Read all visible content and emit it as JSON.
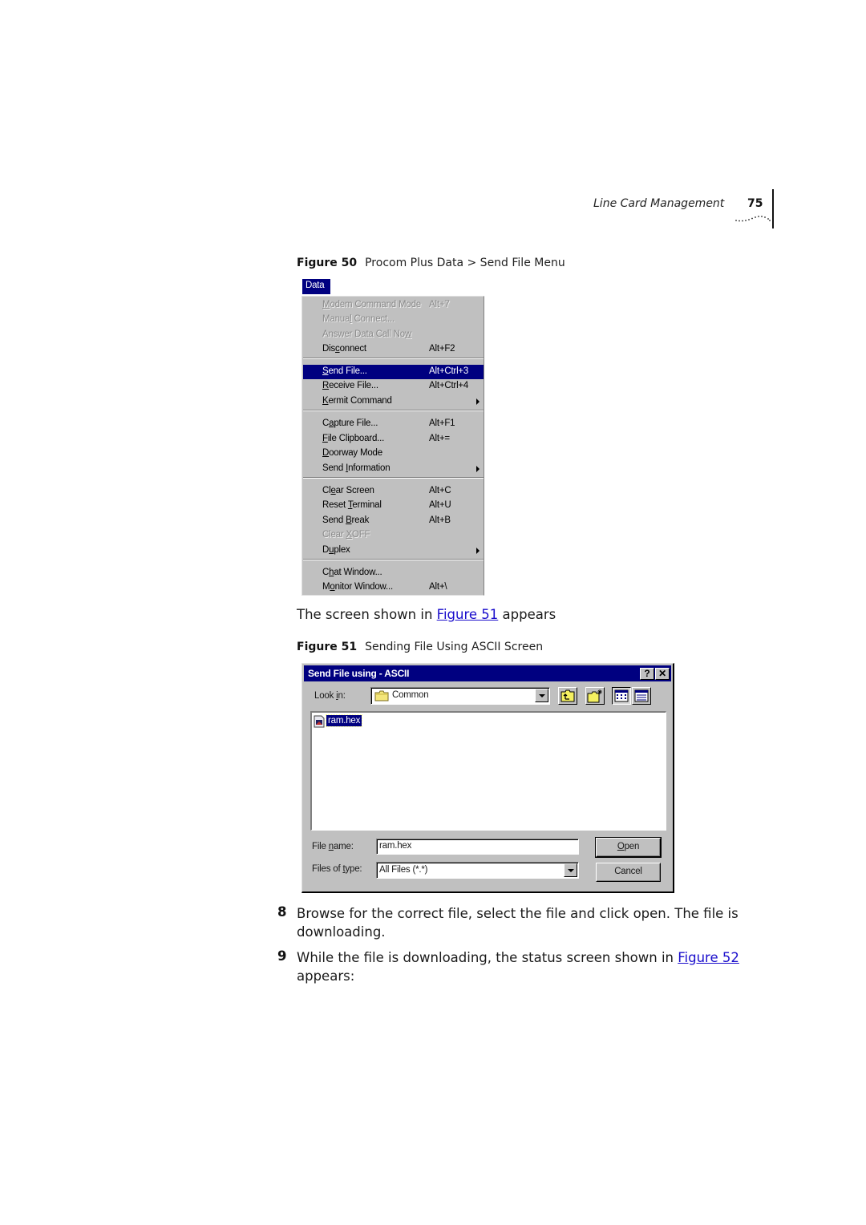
{
  "header": {
    "section_title": "Line Card Management",
    "page_number": "75"
  },
  "figure50": {
    "label": "Figure 50",
    "caption": "Procom Plus Data > Send File Menu",
    "menu": {
      "title": "Data",
      "items": [
        {
          "label": "Modem Command Mode",
          "shortcut": "Alt+7",
          "state": "disabled",
          "submenu": false
        },
        {
          "label": "Manual Connect...",
          "shortcut": "",
          "state": "disabled",
          "submenu": false
        },
        {
          "label": "Answer Data Call Now",
          "shortcut": "",
          "state": "disabled",
          "submenu": false
        },
        {
          "label": "Disconnect",
          "shortcut": "Alt+F2",
          "state": "enabled",
          "submenu": false
        },
        {
          "label": "Send File...",
          "shortcut": "Alt+Ctrl+3",
          "state": "selected",
          "submenu": false
        },
        {
          "label": "Receive File...",
          "shortcut": "Alt+Ctrl+4",
          "state": "enabled",
          "submenu": false
        },
        {
          "label": "Kermit Command",
          "shortcut": "",
          "state": "enabled",
          "submenu": true
        },
        {
          "label": "Capture File...",
          "shortcut": "Alt+F1",
          "state": "enabled",
          "submenu": false
        },
        {
          "label": "File Clipboard...",
          "shortcut": "Alt+=",
          "state": "enabled",
          "submenu": false
        },
        {
          "label": "Doorway Mode",
          "shortcut": "",
          "state": "enabled",
          "submenu": false
        },
        {
          "label": "Send Information",
          "shortcut": "",
          "state": "enabled",
          "submenu": true
        },
        {
          "label": "Clear Screen",
          "shortcut": "Alt+C",
          "state": "enabled",
          "submenu": false
        },
        {
          "label": "Reset Terminal",
          "shortcut": "Alt+U",
          "state": "enabled",
          "submenu": false
        },
        {
          "label": "Send Break",
          "shortcut": "Alt+B",
          "state": "enabled",
          "submenu": false
        },
        {
          "label": "Clear XOFF",
          "shortcut": "",
          "state": "disabled",
          "submenu": false
        },
        {
          "label": "Duplex",
          "shortcut": "",
          "state": "enabled",
          "submenu": true
        },
        {
          "label": "Chat Window...",
          "shortcut": "",
          "state": "enabled",
          "submenu": false
        },
        {
          "label": "Monitor Window...",
          "shortcut": "Alt+\\",
          "state": "enabled",
          "submenu": false
        }
      ]
    }
  },
  "text": {
    "screen_shown_prefix": "The screen shown in ",
    "screen_shown_link": "Figure 51",
    "screen_shown_suffix": " appears",
    "step8_num": "8",
    "step8_line1": "Browse for the correct file, select the file and click open. The file is",
    "step8_line2": "downloading.",
    "step9_num": "9",
    "step9_prefix": "While the file is downloading, the status screen shown in ",
    "step9_link": "Figure 52",
    "step9_line2": "appears:"
  },
  "figure51": {
    "label": "Figure 51",
    "caption": "Sending File Using ASCII Screen",
    "dialog": {
      "title": "Send File using - ASCII",
      "help_button": "?",
      "close_button": "✕",
      "look_in_label": "Look in:",
      "look_in_value": "Common",
      "files": [
        {
          "name": "ram.hex",
          "selected": true
        }
      ],
      "file_name_label": "File name:",
      "file_name_value": "ram.hex",
      "file_type_label": "Files of type:",
      "file_type_value": "All Files (*.*)",
      "open_button": "Open",
      "cancel_button": "Cancel"
    }
  },
  "colors": {
    "titlebar": "#000080",
    "selection": "#000080",
    "dialog_face": "#c0c0c0",
    "link": "#1a0dcc"
  }
}
